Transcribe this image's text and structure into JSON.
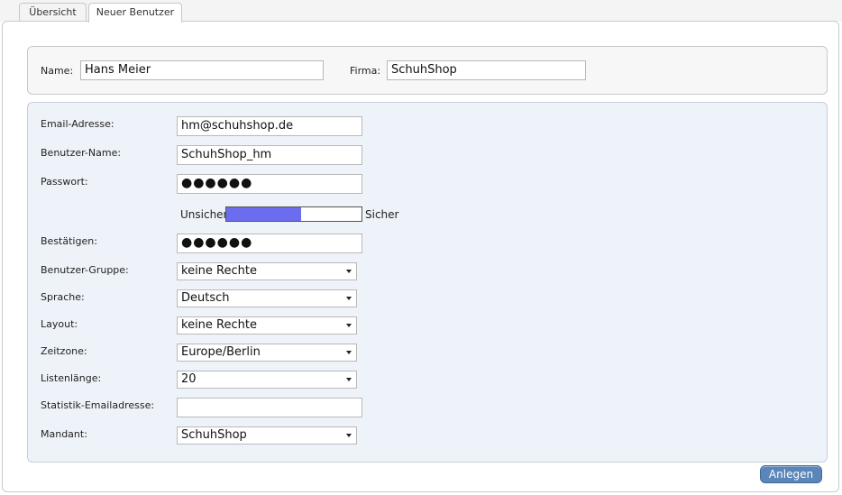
{
  "tabs": [
    {
      "label": "Übersicht",
      "active": false
    },
    {
      "label": "Neuer Benutzer",
      "active": true
    }
  ],
  "top": {
    "name_label": "Name:",
    "name_value": "Hans Meier",
    "firma_label": "Firma:",
    "firma_value": "SchuhShop"
  },
  "form": {
    "email": {
      "label": "Email-Adresse:",
      "value": "hm@schuhshop.de"
    },
    "username": {
      "label": "Benutzer-Name:",
      "value": "SchuhShop_hm"
    },
    "password": {
      "label": "Passwort:",
      "value": "●●●●●●"
    },
    "strength": {
      "weak_label": "Unsicher",
      "strong_label": "Sicher",
      "level": 0.55,
      "color": "#6c6cee"
    },
    "confirm": {
      "label": "Bestätigen:",
      "value": "●●●●●●"
    },
    "group": {
      "label": "Benutzer-Gruppe:",
      "value": "keine Rechte"
    },
    "language": {
      "label": "Sprache:",
      "value": "Deutsch"
    },
    "layout": {
      "label": "Layout:",
      "value": "keine Rechte"
    },
    "timezone": {
      "label": "Zeitzone:",
      "value": "Europe/Berlin"
    },
    "list_length": {
      "label": "Listenlänge:",
      "value": "20"
    },
    "stats_email": {
      "label": "Statistik-Emailadresse:",
      "value": ""
    },
    "client": {
      "label": "Mandant:",
      "value": "SchuhShop"
    }
  },
  "actions": {
    "create_label": "Anlegen"
  },
  "colors": {
    "button": "#5b86b9",
    "form_bg": "#eef3f9",
    "strength": "#6c6cee"
  }
}
